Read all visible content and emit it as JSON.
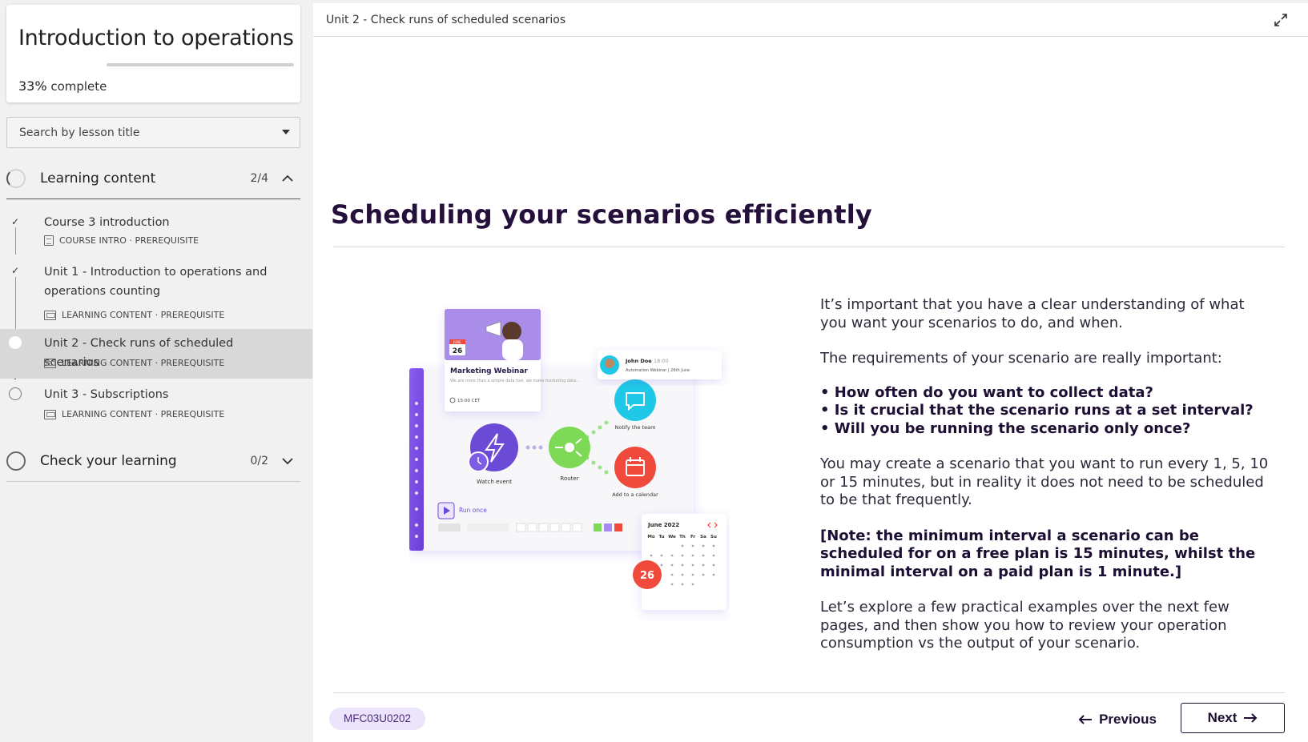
{
  "sidebar": {
    "course_title": "Introduction to operations",
    "progress_value": "33%",
    "progress_fraction": 0.0,
    "progress_suffix": " complete",
    "search_label": "Search by lesson title",
    "sections": [
      {
        "title": "Learning content",
        "count": "2/4",
        "expanded": true,
        "lessons": [
          {
            "title": "Course 3 introduction",
            "meta": "COURSE INTRO · PREREQUISITE",
            "status": "complete",
            "icon": "document-icon"
          },
          {
            "title": "Unit 1 - Introduction to operations and operations counting",
            "meta": "LEARNING CONTENT · PREREQUISITE",
            "status": "complete",
            "icon": "screen-icon"
          },
          {
            "title": "Unit 2 - Check runs of scheduled scenarios",
            "meta": "LEARNING CONTENT · PREREQUISITE",
            "status": "current",
            "icon": "screen-icon"
          },
          {
            "title": "Unit 3 - Subscriptions",
            "meta": "LEARNING CONTENT · PREREQUISITE",
            "status": "not-started",
            "icon": "screen-icon"
          }
        ]
      },
      {
        "title": "Check your learning",
        "count": "0/2",
        "expanded": false
      }
    ]
  },
  "main": {
    "unit_title": "Unit 2 - Check runs of scheduled scenarios",
    "heading": "Scheduling your scenarios efficiently",
    "intro": "It’s important that you have a clear understanding of what you want your scenarios to do, and when.",
    "requirements": "The requirements of your scenario are really important:",
    "bullets": [
      "How often do you want to collect data?",
      "Is it crucial that the scenario runs at a set interval?",
      "Will you be running the scenario only once?"
    ],
    "para2": "You may create a scenario that you want to run every 1, 5, 10 or 15 minutes, but in reality it does not need to be scheduled to be that frequently.",
    "note": "[Note: the minimum interval a scenario can be scheduled for on a free plan is 15 minutes, whilst the minimal interval on a paid plan is 1 minute.]",
    "para3": "Let’s explore a few practical examples over the next few pages, and then show you how to review your operation consumption vs the output of your scenario.",
    "lesson_code": "MFC03U0202",
    "prev_label": "Previous",
    "next_label": "Next"
  },
  "illustration": {
    "webinar_title": "Marketing Webinar",
    "webinar_desc": "We are more than a simple data tool, we make marketing data...",
    "webinar_time": "15:00 CET",
    "webinar_month": "JUNE",
    "webinar_day": "26",
    "person_name": "John Doe",
    "person_time": "18:00",
    "person_sub": "Automation Webinar | 26th June",
    "node1": "Watch event",
    "node2": "Router",
    "node3": "Notify the team",
    "node4": "Add to a calendar",
    "run_once": "Run once",
    "cal_title": "June 2022",
    "cal_days": [
      "Mo",
      "Tu",
      "We",
      "Th",
      "Fr",
      "Sa",
      "Su"
    ],
    "cal_badge": "26"
  },
  "colors": {
    "accent_dark": "#1d0f33",
    "badge_bg": "#ece4fb",
    "purple": "#6b4ad6",
    "green": "#7ed957",
    "cyan": "#1ec8e6",
    "red": "#f04a3c"
  }
}
